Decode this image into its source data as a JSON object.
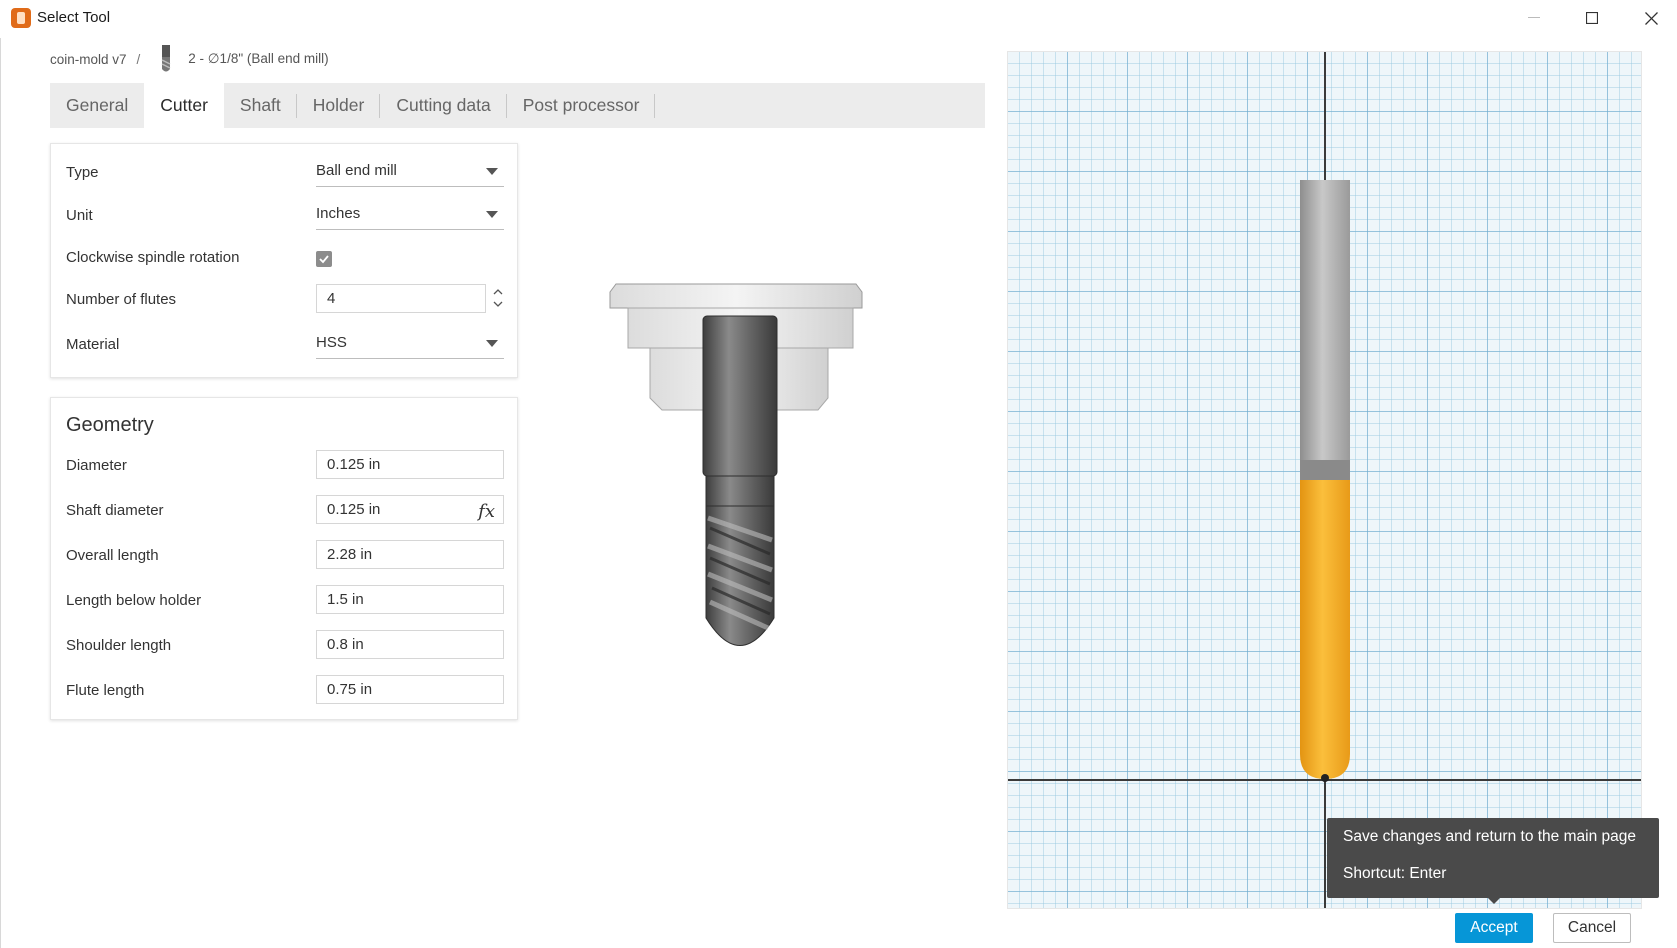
{
  "window": {
    "title": "Select Tool",
    "icon": "fusion-app-icon",
    "controls": [
      "minimize-icon",
      "maximize-icon",
      "close-icon"
    ]
  },
  "breadcrumb": {
    "project": "coin-mold v7",
    "separator": "/",
    "tool": "2 - ∅1/8\" (Ball end mill)"
  },
  "tabs": [
    {
      "label": "General",
      "active": false
    },
    {
      "label": "Cutter",
      "active": true
    },
    {
      "label": "Shaft",
      "active": false
    },
    {
      "label": "Holder",
      "active": false
    },
    {
      "label": "Cutting data",
      "active": false
    },
    {
      "label": "Post processor",
      "active": false
    }
  ],
  "cutter": {
    "type_label": "Type",
    "type_value": "Ball end mill",
    "unit_label": "Unit",
    "unit_value": "Inches",
    "spindle_label": "Clockwise spindle rotation",
    "spindle_checked": true,
    "flutes_label": "Number of flutes",
    "flutes_value": "4",
    "material_label": "Material",
    "material_value": "HSS"
  },
  "geometry": {
    "title": "Geometry",
    "fields": [
      {
        "label": "Diameter",
        "value": "0.125 in"
      },
      {
        "label": "Shaft diameter",
        "value": "0.125 in",
        "has_formula": true
      },
      {
        "label": "Overall length",
        "value": "2.28 in"
      },
      {
        "label": "Length below holder",
        "value": "1.5 in"
      },
      {
        "label": "Shoulder length",
        "value": "0.8 in"
      },
      {
        "label": "Flute length",
        "value": "0.75 in"
      }
    ],
    "formula_icon": "fx"
  },
  "tooltip": {
    "line1": "Save changes and return to the main page",
    "line2": "Shortcut: Enter"
  },
  "buttons": {
    "accept": "Accept",
    "cancel": "Cancel"
  },
  "colors": {
    "accent": "#0696d7",
    "flute": "#f5a623",
    "shank": "#a8a8a8",
    "tooltip_bg": "#4a4a4a"
  }
}
